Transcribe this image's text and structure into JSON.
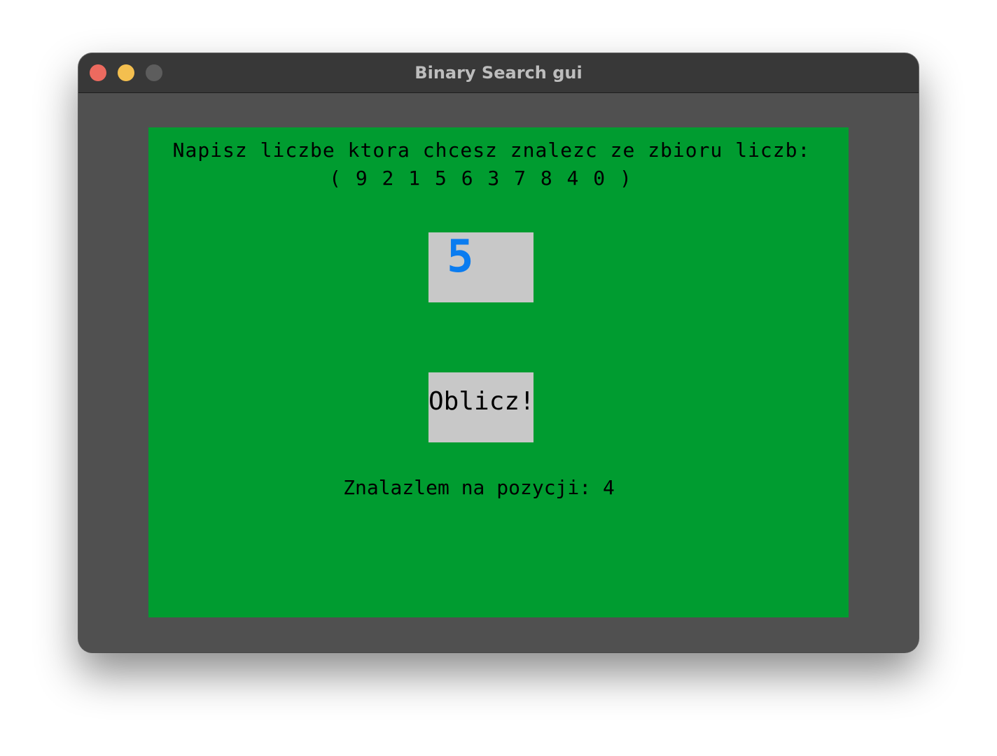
{
  "window": {
    "title": "Binary Search gui"
  },
  "colors": {
    "canvas_bg": "#009c30",
    "input_bg": "#c8c8c8",
    "input_text": "#0a7cf0",
    "button_bg": "#c8c8c8",
    "text": "#000000"
  },
  "main": {
    "prompt": "Napisz liczbe ktora chcesz znalezc ze zbioru liczb:",
    "number_set": "( 9 2 1 5 6 3 7 8 4 0 )",
    "input_value": "5",
    "button_label": "Oblicz!",
    "result": "Znalazlem na pozycji: 4"
  }
}
